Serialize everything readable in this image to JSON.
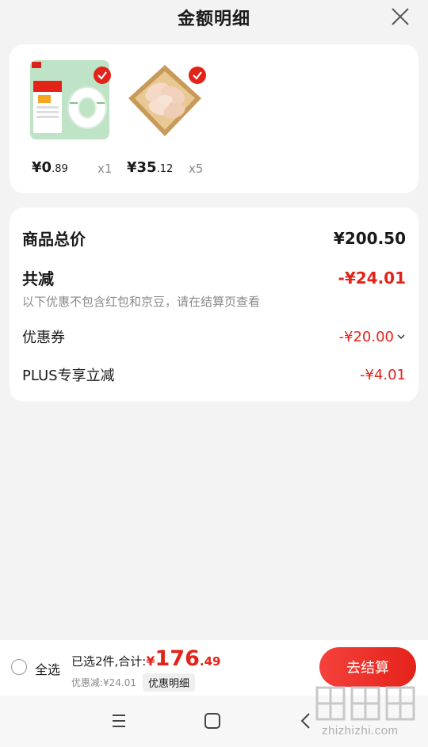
{
  "header": {
    "title": "金额明细"
  },
  "products": [
    {
      "price_int": "¥0",
      "price_dec": ".89",
      "qty": "x1",
      "check_color": "#e3231a"
    },
    {
      "price_int": "¥35",
      "price_dec": ".12",
      "qty": "x5",
      "check_color": "#e3231a"
    }
  ],
  "detail": {
    "total_label": "商品总价",
    "total_value": "¥200.50",
    "discount_label": "共减",
    "discount_value": "-¥24.01",
    "note": "以下优惠不包含红包和京豆，请在结算页查看",
    "coupon_label": "优惠券",
    "coupon_value": "-¥20.00",
    "plus_label": "PLUS专享立减",
    "plus_value": "-¥4.01"
  },
  "bottom_bar": {
    "select_all": "全选",
    "selected_text": "已选2件,合计:",
    "currency": "¥",
    "total_int": "176",
    "total_dec": ".49",
    "discount_text": "优惠减:¥24.01",
    "detail_link": "优惠明细",
    "checkout": "去结算"
  },
  "watermark": {
    "text": "zhizhizhi.com"
  },
  "colors": {
    "accent": "#e3231a",
    "background": "#f3f3f3"
  },
  "icons": {
    "close": "close-icon",
    "menu": "menu-icon",
    "home": "home-icon",
    "back": "back-icon"
  }
}
